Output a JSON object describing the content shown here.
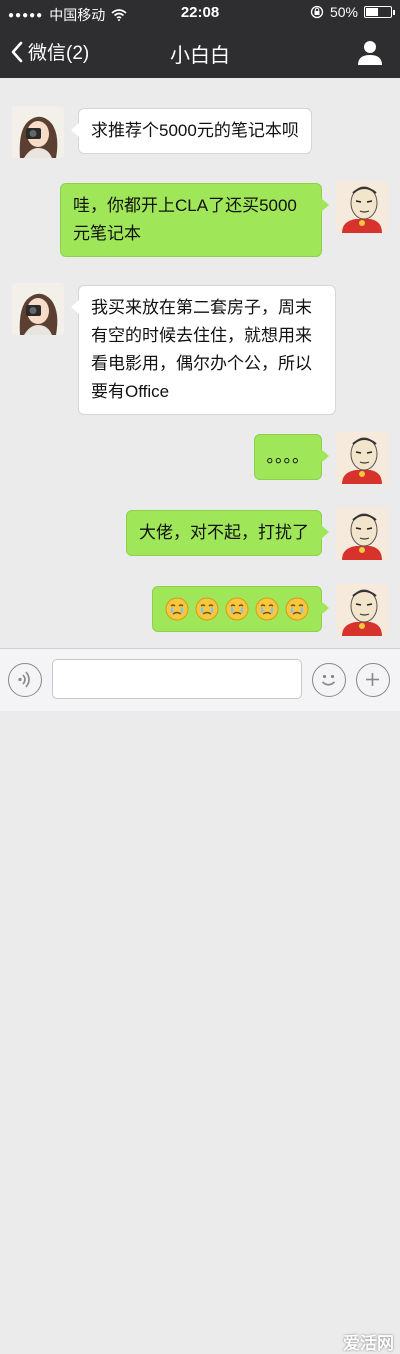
{
  "status_bar": {
    "carrier": "中国移动",
    "time": "22:08",
    "battery_percent": "50%",
    "battery_level": 0.5
  },
  "nav": {
    "back_label": "微信(2)",
    "title": "小白白"
  },
  "messages": [
    {
      "side": "in",
      "text": "求推荐个5000元的笔记本呗"
    },
    {
      "side": "out",
      "text": "哇，你都开上CLA了还买5000元笔记本"
    },
    {
      "side": "in",
      "text": "我买来放在第二套房子，周末有空的时候去住住，就想用来看电影用，偶尔办个公，所以要有Office"
    },
    {
      "side": "out",
      "text": "。。。。"
    },
    {
      "side": "out",
      "text": "大佬，对不起，打扰了"
    },
    {
      "side": "out",
      "emoji_count": 5,
      "emoji_name": "crying-face"
    }
  ],
  "input_bar": {
    "placeholder": ""
  },
  "watermark": "爱活网",
  "colors": {
    "nav_bg": "#2e2e31",
    "chat_bg": "#ebebeb",
    "out_bubble": "#9fe658",
    "in_bubble": "#ffffff"
  },
  "icons": {
    "back": "chevron-left-icon",
    "profile": "person-icon",
    "voice": "voice-icon",
    "emoji": "emoji-icon",
    "plus": "plus-icon"
  }
}
